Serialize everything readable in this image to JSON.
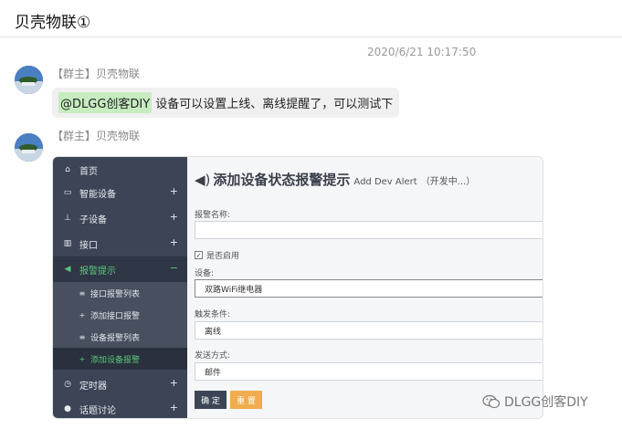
{
  "chat": {
    "title": "贝壳物联①",
    "timestamp": "2020/6/21 10:17:50"
  },
  "messages": [
    {
      "sender": "【群主】贝壳物联",
      "mention": "@DLGG创客DIY",
      "text": "设备可以设置上线、离线提醒了，可以测试下"
    },
    {
      "sender": "【群主】贝壳物联"
    }
  ],
  "app": {
    "sidebar": {
      "items": [
        {
          "label": "首页",
          "icon": "home-icon",
          "plus": ""
        },
        {
          "label": "智能设备",
          "icon": "laptop-icon",
          "plus": "+"
        },
        {
          "label": "子设备",
          "icon": "sitemap-icon",
          "plus": "+"
        },
        {
          "label": "接口",
          "icon": "chart-icon",
          "plus": "+"
        },
        {
          "label": "报警提示",
          "icon": "speaker-icon",
          "plus": "−"
        },
        {
          "label": "定时器",
          "icon": "clock-icon",
          "plus": "+"
        },
        {
          "label": "话题讨论",
          "icon": "comments-icon",
          "plus": "+"
        }
      ],
      "subitems": [
        {
          "label": "接口报警列表",
          "icon": "list-icon"
        },
        {
          "label": "添加接口报警",
          "icon": "plus-icon"
        },
        {
          "label": "设备报警列表",
          "icon": "list-icon"
        },
        {
          "label": "添加设备报警",
          "icon": "plus-icon"
        }
      ]
    },
    "form": {
      "title": "添加设备状态报警提示",
      "title_en": "Add Dev Alert",
      "title_note": "（开发中...）",
      "name_label": "报警名称:",
      "name_value": "",
      "enable_label": "是否启用",
      "enable_checked": true,
      "device_label": "设备:",
      "device_value": "双路WiFi继电器",
      "trigger_label": "触发条件:",
      "trigger_value": "离线",
      "send_label": "发送方式:",
      "send_value": "邮件",
      "ok_label": "确 定",
      "reset_label": "重 置"
    }
  },
  "watermark": "DLGG创客DIY",
  "colors": {
    "sidebar_bg": "#3c4456",
    "accent_green": "#5ac77b",
    "reset_button": "#f0ad4e",
    "mention_bg": "#c6ecc0"
  }
}
